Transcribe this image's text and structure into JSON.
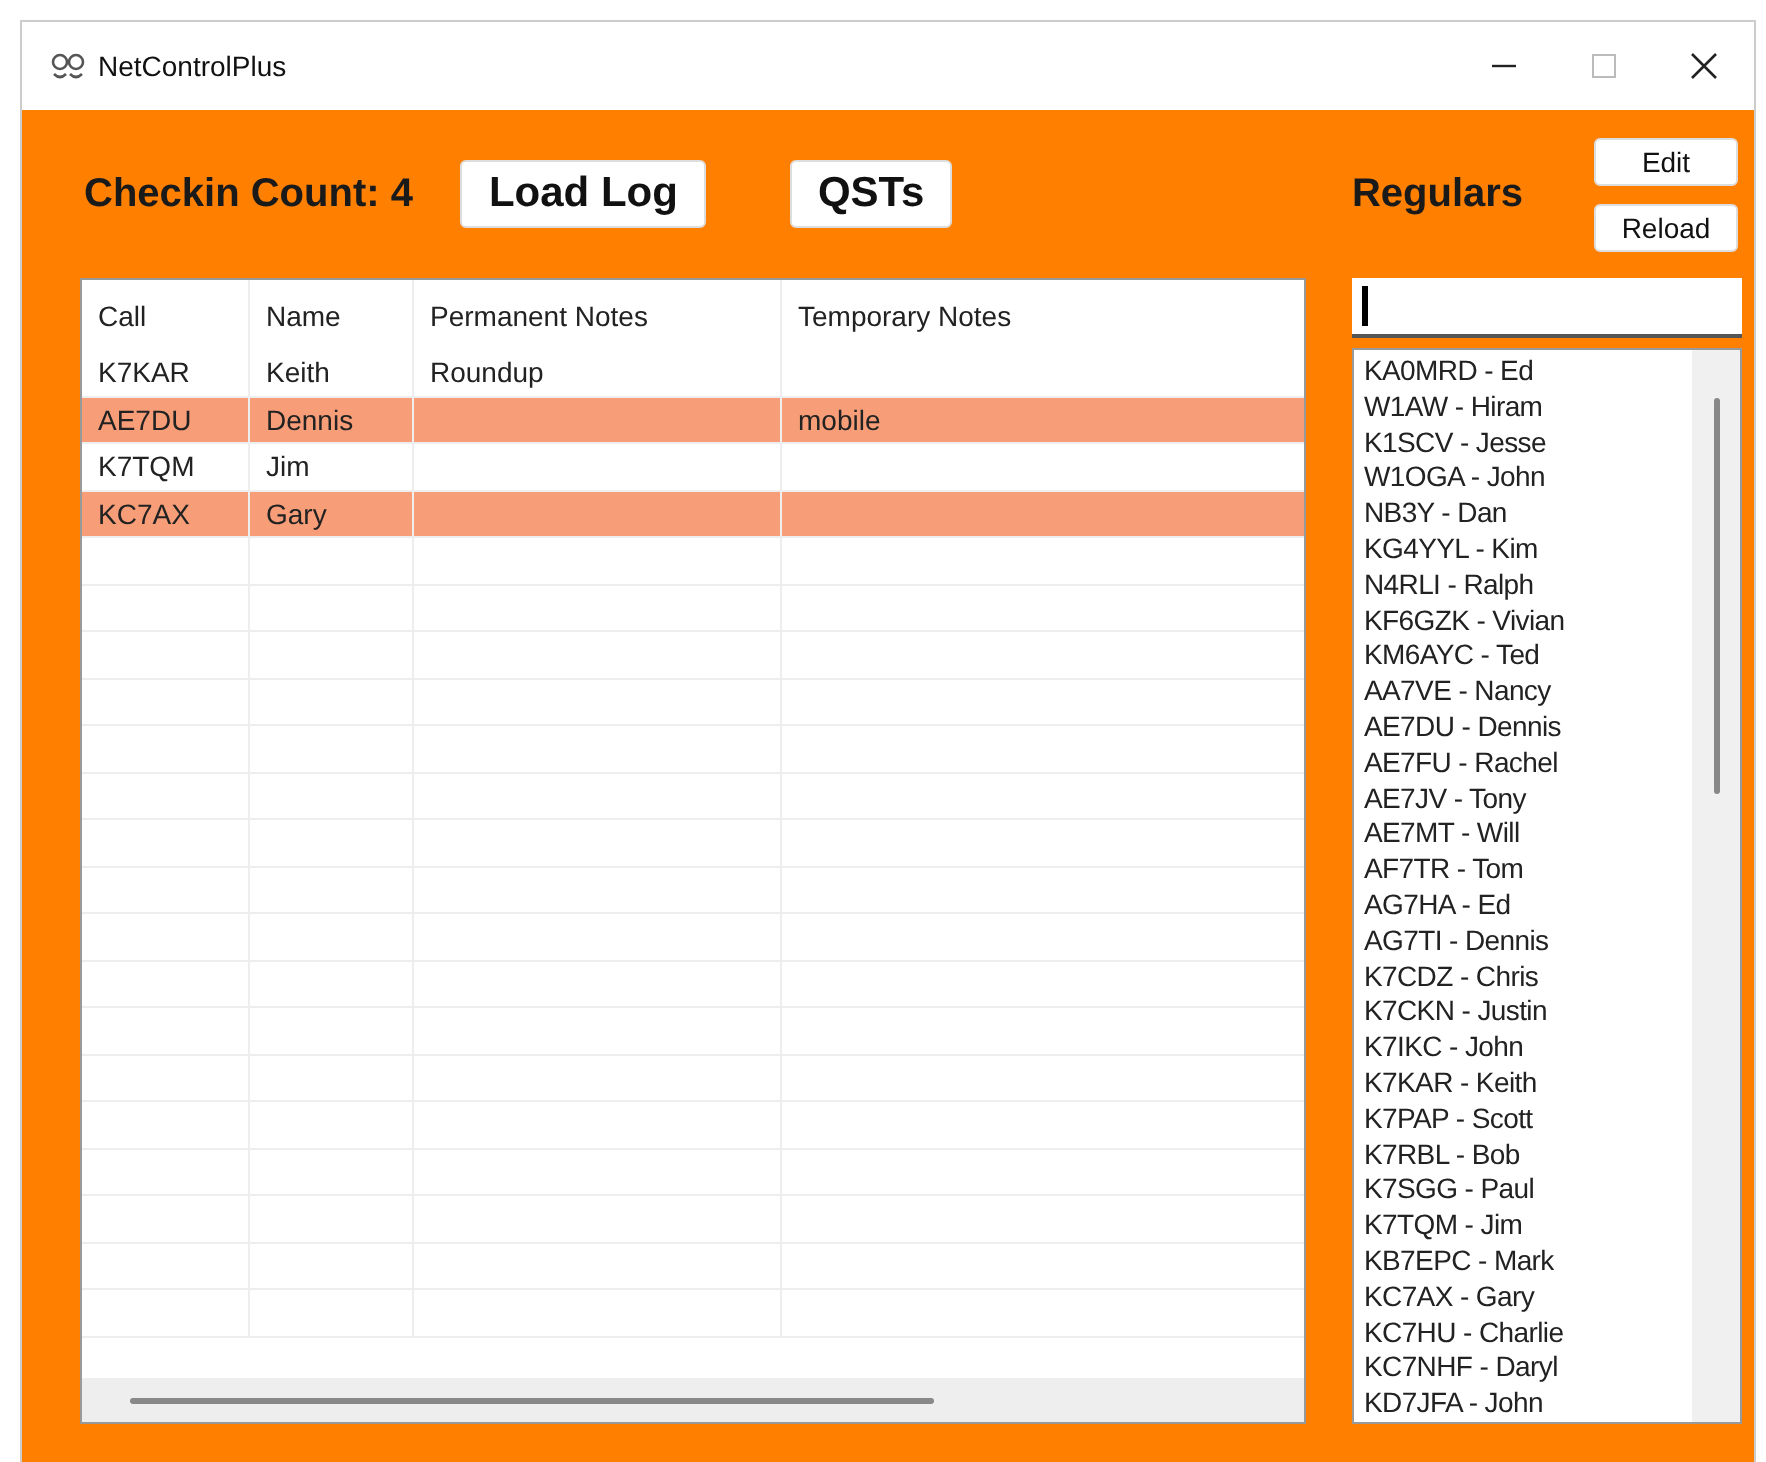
{
  "window": {
    "title": "NetControlPlus"
  },
  "toolbar": {
    "checkin_count": "Checkin Count: 4",
    "buttons": [
      "Load Log",
      "QSTs"
    ]
  },
  "table": {
    "columns": [
      "Call",
      "Name",
      "Permanent Notes",
      "Temporary Notes"
    ],
    "rows": [
      {
        "cells": [
          "K7KAR",
          "Keith",
          "Roundup",
          ""
        ],
        "highlighted": false
      },
      {
        "cells": [
          "AE7DU",
          "Dennis",
          "",
          "mobile"
        ],
        "highlighted": true
      },
      {
        "cells": [
          "K7TQM",
          "Jim",
          "",
          ""
        ],
        "highlighted": false
      },
      {
        "cells": [
          "KC7AX",
          "Gary",
          "",
          ""
        ],
        "highlighted": true
      }
    ]
  },
  "regulars": {
    "title": "Regulars",
    "buttons": [
      "Edit",
      "Reload"
    ],
    "items": [
      "KA0MRD - Ed",
      "W1AW - Hiram",
      "K1SCV - Jesse",
      "W1OGA - John",
      "NB3Y - Dan",
      "KG4YYL - Kim",
      "N4RLI - Ralph",
      "KF6GZK - Vivian",
      "KM6AYC - Ted",
      "AA7VE - Nancy",
      "AE7DU - Dennis",
      "AE7FU - Rachel",
      "AE7JV - Tony",
      "AE7MT - Will",
      "AF7TR - Tom",
      "AG7HA - Ed",
      "AG7TI - Dennis",
      "K7CDZ - Chris",
      "K7CKN - Justin",
      "K7IKC - John",
      "K7KAR - Keith",
      "K7PAP - Scott",
      "K7RBL - Bob",
      "K7SGG - Paul",
      "K7TQM - Jim",
      "KB7EPC - Mark",
      "KC7AX - Gary",
      "KC7HU - Charlie",
      "KC7NHF - Daryl",
      "KD7JFA - John"
    ]
  }
}
